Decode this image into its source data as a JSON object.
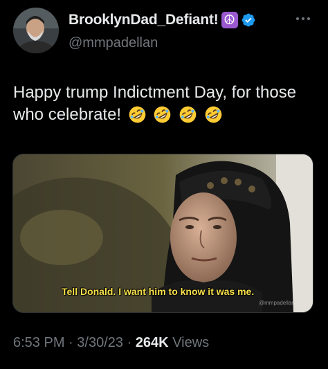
{
  "user": {
    "display_name": "BrooklynDad_Defiant!",
    "name_emoji": "☮",
    "handle": "@mmpadellan",
    "verified": true
  },
  "tweet": {
    "text": "Happy trump Indictment Day, for those who celebrate!",
    "emojis": [
      "rolling-on-floor-laughing",
      "rolling-on-floor-laughing",
      "rolling-on-floor-laughing",
      "rolling-on-floor-laughing"
    ]
  },
  "media": {
    "caption": "Tell Donald. I want him to know it was me.",
    "watermark": "@mmpadellan"
  },
  "meta": {
    "time": "6:53 PM",
    "date": "3/30/23",
    "sep": "·",
    "views_count": "264K",
    "views_label": "Views"
  },
  "colors": {
    "background": "#000000",
    "text": "#e7e9ea",
    "secondary": "#71767b",
    "verified": "#1d9bf0",
    "caption": "#f6e04a"
  }
}
